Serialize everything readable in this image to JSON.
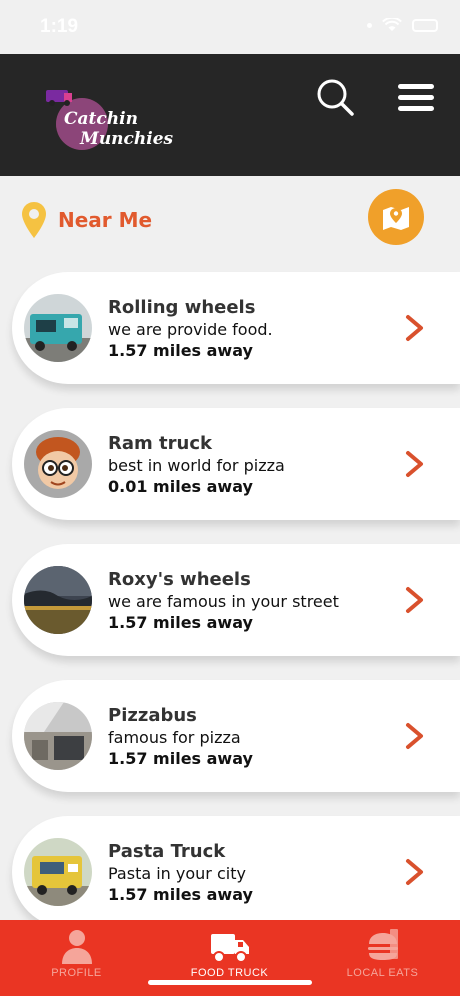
{
  "status": {
    "time": "1:19"
  },
  "header": {
    "logo_text_line1": "Catchin",
    "logo_text_line2": "Munchies"
  },
  "near_me": {
    "label": "Near Me"
  },
  "trucks": [
    {
      "name": "Rolling wheels",
      "desc": "we are provide food.",
      "distance": "1.57 miles away",
      "thumb": "teal-truck"
    },
    {
      "name": "Ram truck",
      "desc": "best in world for pizza",
      "distance": "0.01 miles away",
      "thumb": "cartoon-boy"
    },
    {
      "name": "Roxy's wheels",
      "desc": "we are famous in your street",
      "distance": "1.57 miles away",
      "thumb": "stormy-sky"
    },
    {
      "name": "Pizzabus",
      "desc": "famous for pizza",
      "distance": "1.57 miles away",
      "thumb": "building"
    },
    {
      "name": "Pasta Truck",
      "desc": "Pasta in your city",
      "distance": "1.57 miles away",
      "thumb": "yellow-truck"
    }
  ],
  "tabs": [
    {
      "label": "PROFILE",
      "icon": "person-icon",
      "active": false
    },
    {
      "label": "FOOD TRUCK",
      "icon": "truck-icon",
      "active": true
    },
    {
      "label": "LOCAL EATS",
      "icon": "burger-icon",
      "active": false
    }
  ],
  "colors": {
    "accent": "#e15a2e",
    "tabbar": "#ea3523",
    "header": "#262626",
    "map_button": "#f0a02a"
  }
}
